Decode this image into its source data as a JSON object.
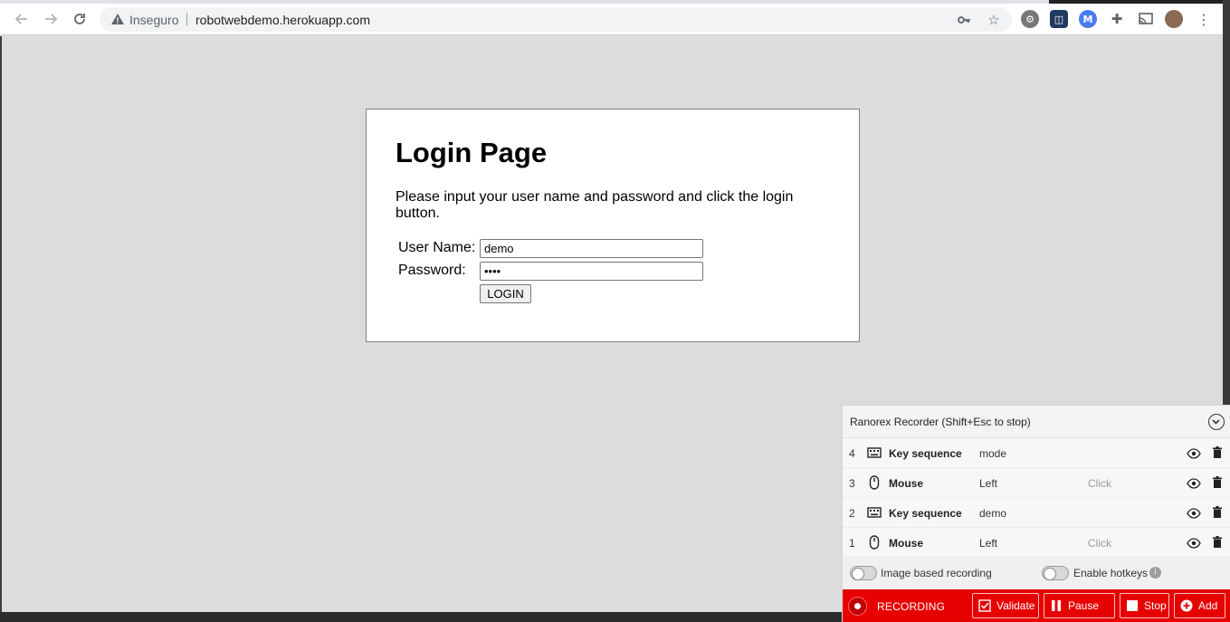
{
  "browser": {
    "security_label": "Inseguro",
    "url": "robotwebdemo.herokuapp.com"
  },
  "login": {
    "title": "Login Page",
    "intro": "Please input your user name and password and click the login button.",
    "username_label": "User Name:",
    "username_value": "demo",
    "password_label": "Password:",
    "password_value": "mode",
    "button_label": "LOGIN"
  },
  "recorder": {
    "title": "Ranorex Recorder (Shift+Esc to stop)",
    "rows": [
      {
        "num": "4",
        "icon": "keyboard-icon",
        "type": "Key sequence",
        "value": "mode",
        "action": ""
      },
      {
        "num": "3",
        "icon": "mouse-icon",
        "type": "Mouse",
        "value": "Left",
        "action": "Click"
      },
      {
        "num": "2",
        "icon": "keyboard-icon",
        "type": "Key sequence",
        "value": "demo",
        "action": ""
      },
      {
        "num": "1",
        "icon": "mouse-icon",
        "type": "Mouse",
        "value": "Left",
        "action": "Click"
      }
    ],
    "options": {
      "image_based": "Image based recording",
      "hotkeys": "Enable hotkeys"
    },
    "status": "RECORDING",
    "buttons": {
      "validate": "Validate",
      "pause": "Pause",
      "stop": "Stop",
      "add": "Add"
    },
    "colors": {
      "bar": "#e60000"
    }
  }
}
